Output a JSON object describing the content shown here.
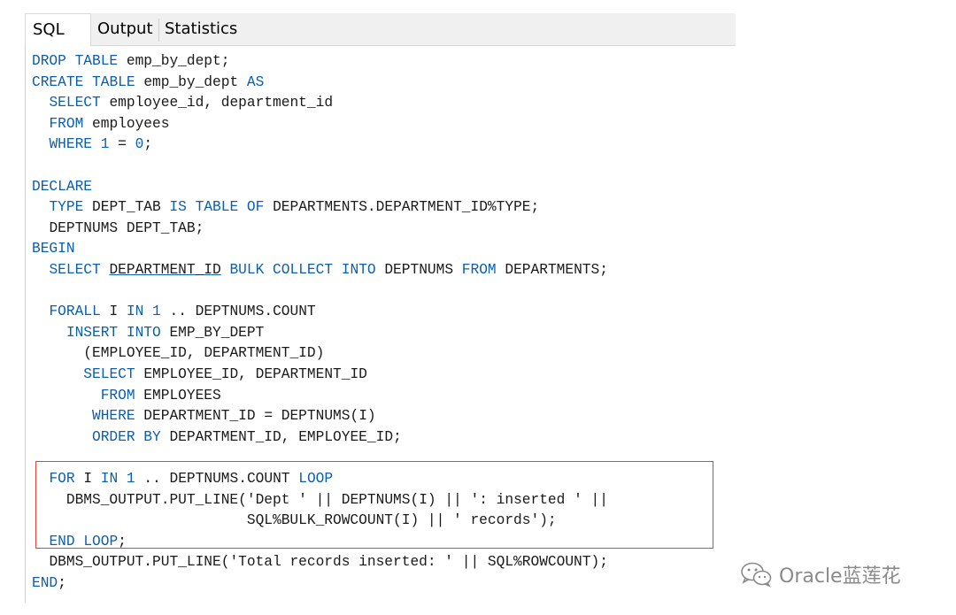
{
  "tabs": [
    {
      "label": "SQL",
      "active": true
    },
    {
      "label": "Output",
      "active": false
    },
    {
      "label": "Statistics",
      "active": false
    }
  ],
  "code_lines": [
    "DROP TABLE emp_by_dept;",
    "CREATE TABLE emp_by_dept AS",
    "  SELECT employee_id, department_id",
    "  FROM employees",
    "  WHERE 1 = 0;",
    "",
    "DECLARE",
    "  TYPE DEPT_TAB IS TABLE OF DEPARTMENTS.DEPARTMENT_ID%TYPE;",
    "  DEPTNUMS DEPT_TAB;",
    "BEGIN",
    "  SELECT DEPARTMENT_ID BULK COLLECT INTO DEPTNUMS FROM DEPARTMENTS;",
    "",
    "  FORALL I IN 1 .. DEPTNUMS.COUNT",
    "    INSERT INTO EMP_BY_DEPT",
    "      (EMPLOYEE_ID, DEPARTMENT_ID)",
    "      SELECT EMPLOYEE_ID, DEPARTMENT_ID",
    "        FROM EMPLOYEES",
    "       WHERE DEPARTMENT_ID = DEPTNUMS(I)",
    "       ORDER BY DEPARTMENT_ID, EMPLOYEE_ID;",
    "",
    "  FOR I IN 1 .. DEPTNUMS.COUNT LOOP",
    "    DBMS_OUTPUT.PUT_LINE('Dept ' || DEPTNUMS(I) || ': inserted ' ||",
    "                         SQL%BULK_ROWCOUNT(I) || ' records');",
    "  END LOOP;",
    "  DBMS_OUTPUT.PUT_LINE('Total records inserted: ' || SQL%ROWCOUNT);",
    "END;"
  ],
  "keyword_color": "#0b5fb0",
  "highlight_color": "#e8413b",
  "watermark": {
    "text": "Oracle蓝莲花",
    "icon": "wechat-icon"
  }
}
